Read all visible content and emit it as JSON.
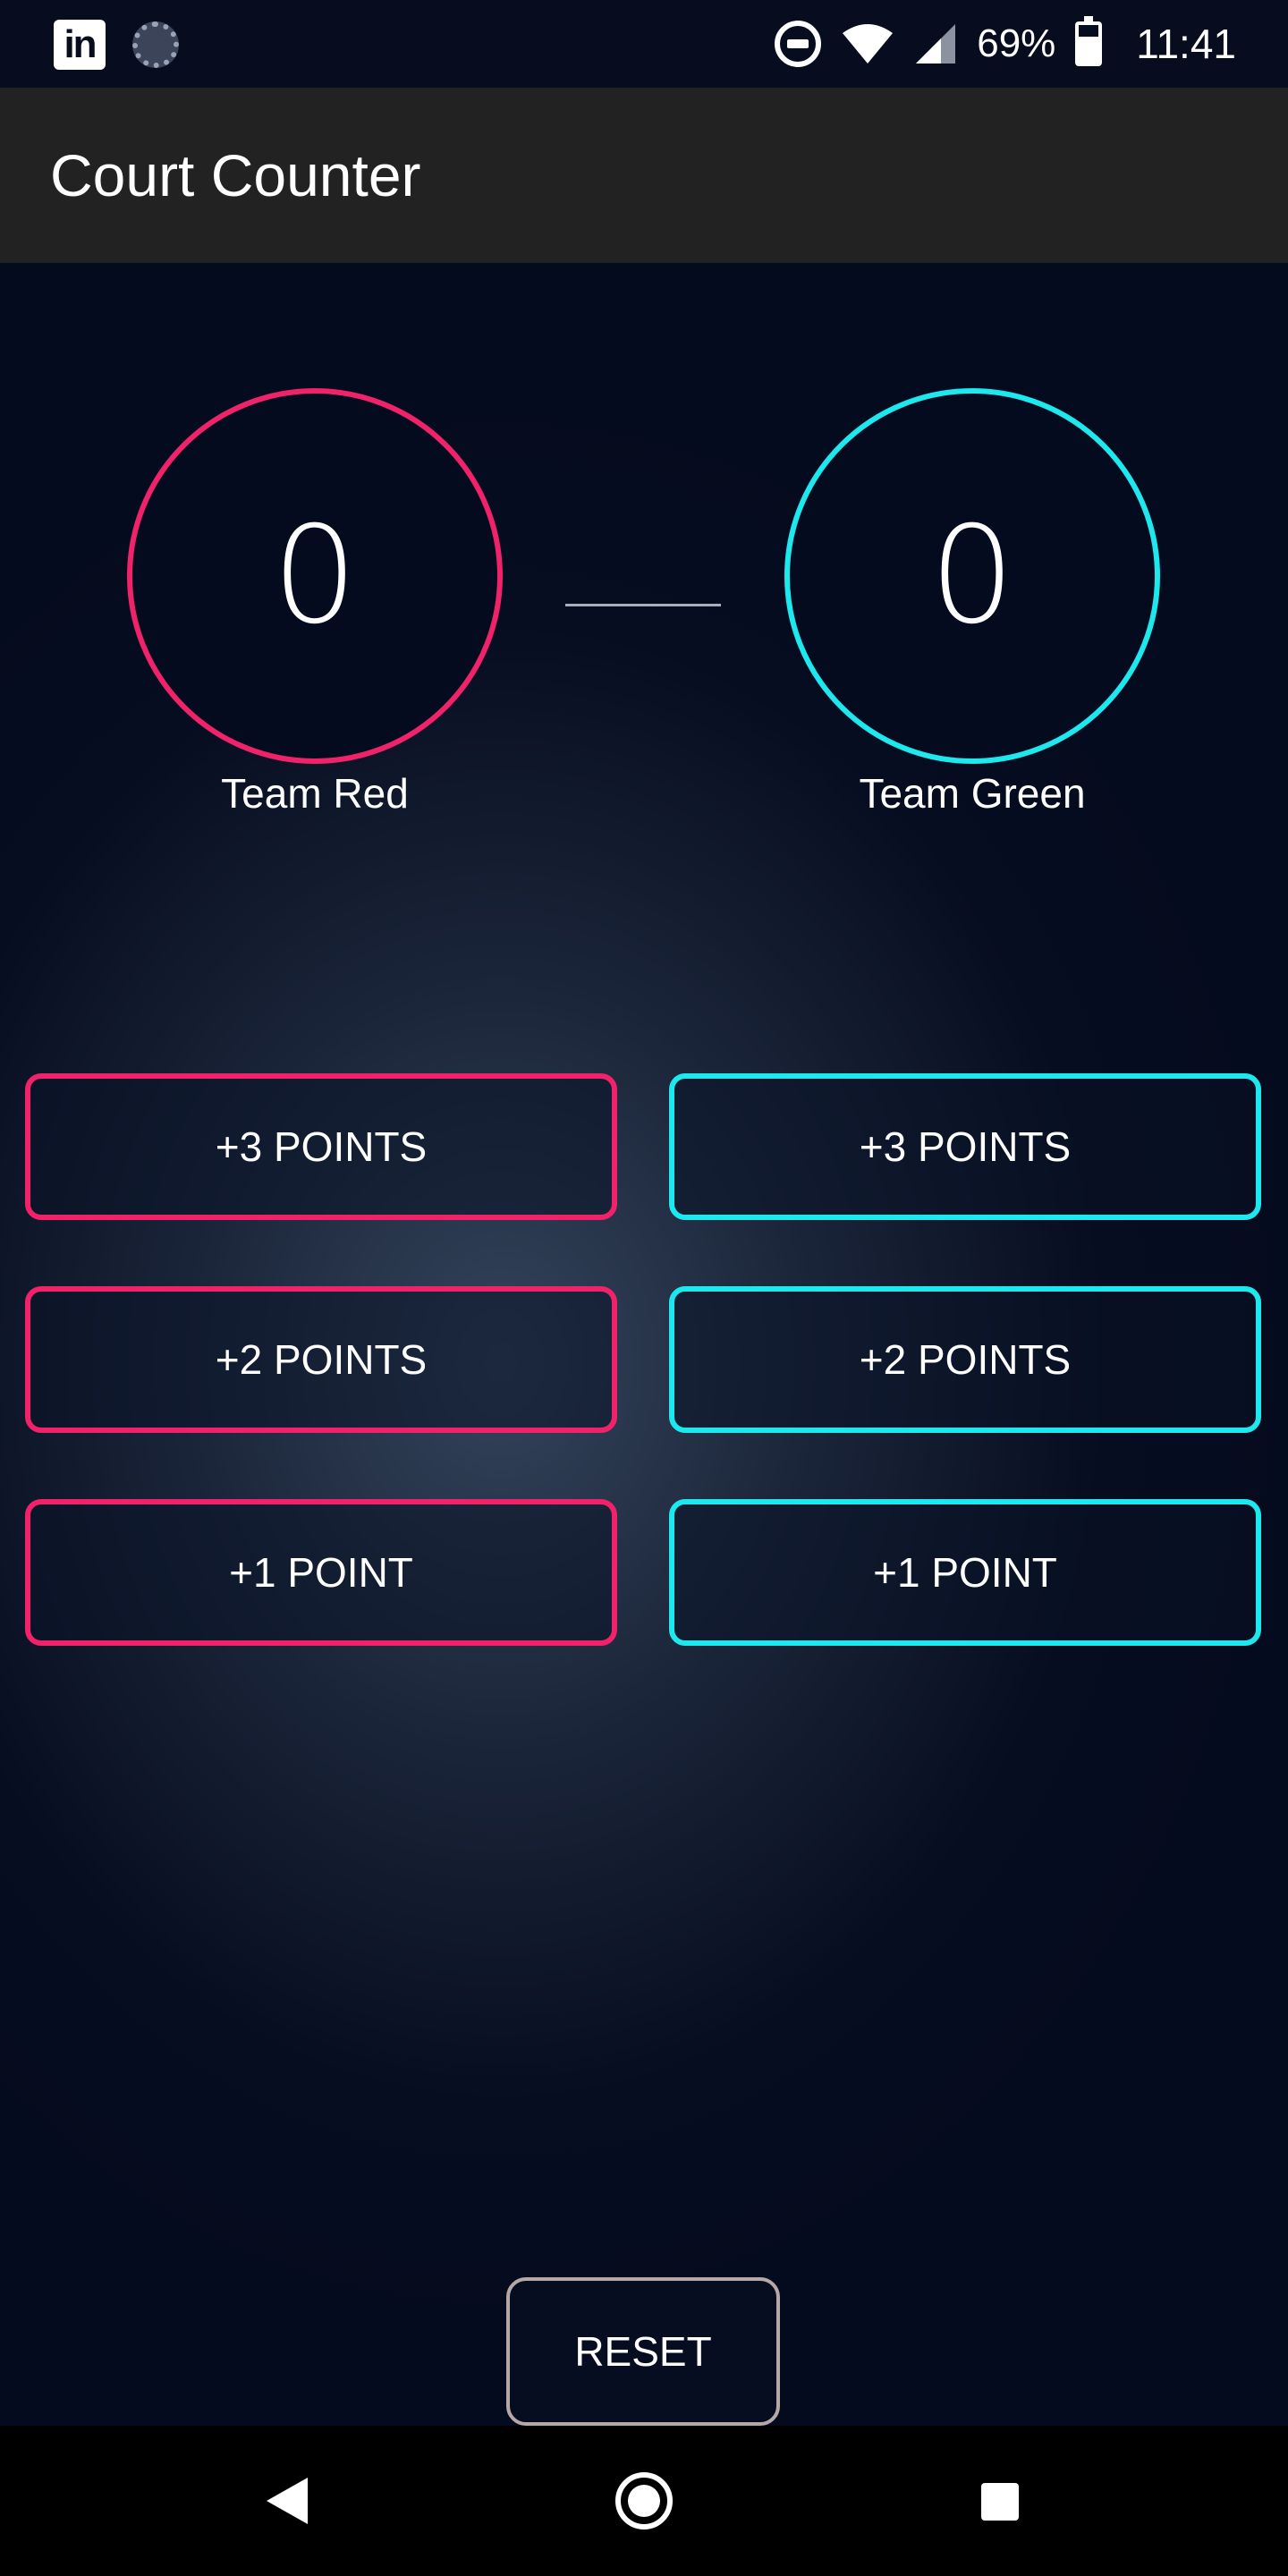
{
  "status_bar": {
    "battery": "69%",
    "time": "11:41",
    "icons": [
      "linkedin-icon",
      "sync-icon",
      "do-not-disturb-icon",
      "wifi-icon",
      "signal-icon",
      "battery-charging-icon"
    ]
  },
  "app_bar": {
    "title": "Court Counter"
  },
  "scoreboard": {
    "team_red": {
      "score": "0",
      "name": "Team Red",
      "color": "#f0226a"
    },
    "team_green": {
      "score": "0",
      "name": "Team Green",
      "color": "#1de8ee"
    }
  },
  "buttons": {
    "red": {
      "plus3": "+3 POINTS",
      "plus2": "+2 POINTS",
      "plus1": "+1 POINT"
    },
    "green": {
      "plus3": "+3 POINTS",
      "plus2": "+2 POINTS",
      "plus1": "+1 POINT"
    }
  },
  "reset": {
    "label": "RESET"
  },
  "nav_bar": {
    "icons": [
      "back-icon",
      "home-icon",
      "recent-apps-icon"
    ]
  }
}
